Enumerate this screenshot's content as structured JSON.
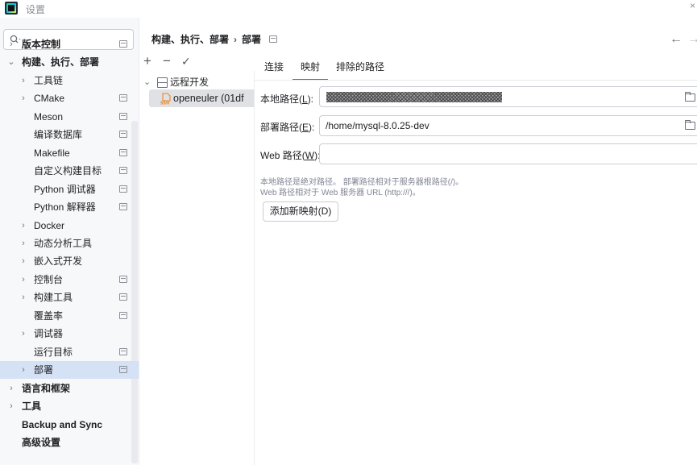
{
  "window": {
    "title": "设置"
  },
  "search": {
    "placeholder": "",
    "value": ""
  },
  "sidebar": {
    "items": [
      {
        "label": "版本控制",
        "bold": true
      },
      {
        "label": "构建、执行、部署",
        "bold": true
      },
      {
        "label": "工具链"
      },
      {
        "label": "CMake"
      },
      {
        "label": "Meson"
      },
      {
        "label": "编译数据库"
      },
      {
        "label": "Makefile"
      },
      {
        "label": "自定义构建目标"
      },
      {
        "label": "Python 调试器"
      },
      {
        "label": "Python 解释器"
      },
      {
        "label": "Docker"
      },
      {
        "label": "动态分析工具"
      },
      {
        "label": "嵌入式开发"
      },
      {
        "label": "控制台"
      },
      {
        "label": "构建工具"
      },
      {
        "label": "覆盖率"
      },
      {
        "label": "调试器"
      },
      {
        "label": "运行目标"
      },
      {
        "label": "部署",
        "selected": true
      },
      {
        "label": "语言和框架",
        "bold": true
      },
      {
        "label": "工具",
        "bold": true
      },
      {
        "label": "Backup and Sync",
        "bold": true
      },
      {
        "label": "高级设置",
        "bold": true
      }
    ]
  },
  "breadcrumb": {
    "parent": "构建、执行、部署",
    "separator": "›",
    "current": "部署"
  },
  "toolbar": {
    "add": "+",
    "remove": "−",
    "apply": "✓"
  },
  "servers": {
    "group": "远程开发",
    "item": "openeuler (01df"
  },
  "tabs": [
    {
      "label": "连接"
    },
    {
      "label": "映射",
      "active": true
    },
    {
      "label": "排除的路径"
    }
  ],
  "form": {
    "local_path": {
      "label_pre": "本地路径(",
      "mnemonic": "L",
      "label_post": "):"
    },
    "deploy_path": {
      "label_pre": "部署路径(",
      "mnemonic": "E",
      "label_post": "):",
      "value": "/home/mysql-8.0.25-dev"
    },
    "web_path": {
      "label_pre": "Web 路径(",
      "mnemonic": "W",
      "label_post": "):",
      "value": ""
    },
    "hint_line1": "本地路径是绝对路径。 部署路径相对于服务器根路径(/)。",
    "hint_line2": "Web 路径相对于 Web 服务器 URL (http:///)。",
    "add_mapping_button": "添加新映射(D)"
  },
  "colors": {
    "accent": "#3574f0",
    "selection": "#d5e1f5",
    "sidebar_bg": "#f7f8fa"
  }
}
